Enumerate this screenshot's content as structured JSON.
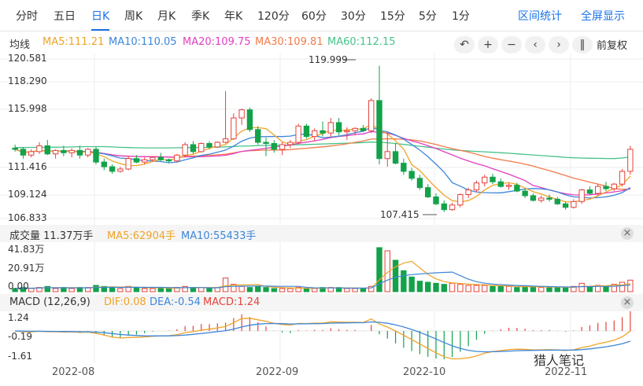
{
  "tabs": [
    "分时",
    "五日",
    "日K",
    "周K",
    "月K",
    "季K",
    "年K",
    "120分",
    "60分",
    "30分",
    "15分",
    "5分",
    "1分"
  ],
  "active_tab": "日K",
  "right_links": [
    "区间统计",
    "全屏显示"
  ],
  "ma_bar": {
    "label": "均线",
    "ma5": "MA5:111.21",
    "ma10": "MA10:110.05",
    "ma20": "MA20:109.75",
    "ma30": "MA30:109.81",
    "ma60": "MA60:112.15"
  },
  "tools": [
    "↶",
    "+",
    "−",
    "‹",
    "›",
    "‖"
  ],
  "adjust": "前复权",
  "price_axis": [
    "120.581",
    "118.290",
    "115.998",
    "111.416",
    "109.124",
    "106.833"
  ],
  "annotations": {
    "high": "119.999",
    "low": "107.415"
  },
  "vol_bar": {
    "label": "成交量 11.37万手",
    "ma5": "MA5:62904手",
    "ma10": "MA10:55433手"
  },
  "vol_axis": [
    "41.83万",
    "20.91万",
    "0.00"
  ],
  "macd_bar": {
    "label": "MACD (12,26,9)",
    "dif": "DIF:0.08",
    "dea": "DEA:-0.54",
    "macd": "MACD:1.24"
  },
  "macd_axis": [
    "1.24",
    "-0.19",
    "-1.61"
  ],
  "dates": [
    "2022-08",
    "2022-09",
    "2022-10",
    "2022-11"
  ],
  "watermark": "猎人笔记",
  "colors": {
    "up": "#e5433b",
    "down": "#13a24a",
    "ma5": "#f0a327",
    "ma10": "#3d86d8",
    "ma20": "#e23fbf",
    "ma30": "#f37a4a",
    "ma60": "#46c28b",
    "link": "#1a73e8"
  },
  "chart_data": {
    "type": "candlestick",
    "ylim": [
      106.833,
      120.581
    ],
    "ohlc": [
      [
        112.9,
        113.2,
        112.6,
        112.8
      ],
      [
        112.8,
        113.0,
        112.0,
        112.3
      ],
      [
        112.3,
        112.8,
        112.1,
        112.6
      ],
      [
        112.6,
        113.4,
        112.4,
        113.1
      ],
      [
        113.1,
        113.6,
        112.3,
        112.4
      ],
      [
        112.4,
        112.8,
        112.0,
        112.7
      ],
      [
        112.7,
        113.1,
        112.2,
        112.5
      ],
      [
        112.5,
        112.9,
        112.1,
        112.7
      ],
      [
        112.7,
        113.1,
        112.0,
        112.3
      ],
      [
        112.3,
        112.9,
        112.1,
        112.8
      ],
      [
        112.8,
        113.0,
        111.5,
        111.7
      ],
      [
        111.7,
        112.0,
        111.0,
        111.3
      ],
      [
        111.3,
        111.5,
        110.7,
        110.9
      ],
      [
        110.9,
        111.3,
        110.8,
        111.1
      ],
      [
        111.1,
        112.2,
        111.0,
        112.0
      ],
      [
        112.0,
        112.3,
        111.6,
        111.7
      ],
      [
        111.7,
        112.1,
        111.5,
        111.9
      ],
      [
        111.9,
        112.2,
        111.7,
        112.1
      ],
      [
        112.1,
        112.5,
        111.8,
        111.9
      ],
      [
        111.9,
        112.0,
        111.6,
        111.8
      ],
      [
        111.8,
        112.4,
        111.7,
        112.3
      ],
      [
        112.3,
        113.4,
        112.1,
        113.2
      ],
      [
        113.2,
        113.5,
        112.4,
        112.6
      ],
      [
        112.6,
        113.4,
        112.5,
        113.3
      ],
      [
        113.3,
        113.5,
        112.8,
        113.0
      ],
      [
        113.0,
        113.5,
        112.9,
        113.4
      ],
      [
        113.4,
        117.8,
        113.3,
        113.7
      ],
      [
        113.7,
        115.9,
        113.6,
        115.5
      ],
      [
        115.5,
        116.3,
        114.9,
        116.2
      ],
      [
        116.2,
        116.4,
        114.3,
        114.5
      ],
      [
        114.5,
        114.8,
        113.2,
        113.4
      ],
      [
        113.4,
        113.8,
        112.2,
        113.3
      ],
      [
        113.3,
        113.6,
        112.5,
        112.8
      ],
      [
        112.8,
        113.4,
        112.3,
        113.2
      ],
      [
        113.2,
        113.6,
        112.9,
        113.4
      ],
      [
        113.4,
        115.0,
        113.2,
        114.8
      ],
      [
        114.8,
        115.0,
        113.7,
        113.9
      ],
      [
        113.9,
        114.6,
        113.5,
        114.4
      ],
      [
        114.4,
        115.2,
        113.9,
        114.2
      ],
      [
        114.2,
        115.5,
        113.8,
        115.1
      ],
      [
        115.1,
        115.5,
        114.0,
        114.3
      ],
      [
        114.3,
        114.7,
        113.6,
        114.4
      ],
      [
        114.4,
        114.7,
        114.0,
        114.6
      ],
      [
        114.6,
        114.9,
        114.3,
        114.4
      ],
      [
        114.4,
        117.2,
        114.2,
        117.0
      ],
      [
        117.0,
        120.0,
        111.5,
        112.0
      ],
      [
        112.0,
        114.2,
        111.3,
        112.6
      ],
      [
        112.6,
        113.3,
        111.5,
        111.6
      ],
      [
        111.6,
        112.0,
        110.6,
        110.9
      ],
      [
        110.9,
        111.2,
        110.1,
        110.3
      ],
      [
        110.3,
        110.6,
        109.3,
        109.5
      ],
      [
        109.5,
        109.8,
        108.6,
        108.7
      ],
      [
        108.7,
        109.0,
        108.0,
        108.1
      ],
      [
        108.1,
        108.4,
        107.4,
        107.6
      ],
      [
        107.6,
        108.2,
        107.5,
        108.0
      ],
      [
        108.0,
        109.0,
        107.8,
        108.9
      ],
      [
        108.9,
        109.5,
        108.6,
        109.3
      ],
      [
        109.3,
        110.1,
        109.1,
        109.9
      ],
      [
        109.9,
        110.6,
        109.6,
        110.4
      ],
      [
        110.4,
        110.7,
        109.8,
        110.0
      ],
      [
        110.0,
        110.3,
        109.5,
        109.6
      ],
      [
        109.6,
        109.9,
        109.3,
        109.7
      ],
      [
        109.7,
        109.9,
        109.1,
        109.2
      ],
      [
        109.2,
        109.4,
        108.6,
        108.8
      ],
      [
        108.8,
        109.0,
        108.3,
        108.4
      ],
      [
        108.4,
        108.8,
        108.2,
        108.6
      ],
      [
        108.6,
        108.9,
        108.3,
        108.5
      ],
      [
        108.5,
        108.7,
        108.0,
        108.1
      ],
      [
        108.1,
        108.3,
        107.6,
        107.8
      ],
      [
        107.8,
        108.5,
        107.7,
        108.3
      ],
      [
        108.3,
        109.4,
        108.1,
        109.3
      ],
      [
        109.3,
        109.6,
        108.9,
        109.0
      ],
      [
        109.0,
        109.8,
        108.8,
        109.6
      ],
      [
        109.6,
        110.0,
        109.2,
        109.4
      ],
      [
        109.4,
        109.9,
        109.2,
        109.8
      ],
      [
        109.8,
        111.1,
        109.6,
        110.9
      ],
      [
        110.9,
        113.1,
        110.6,
        112.8
      ]
    ],
    "volume": [
      3,
      4,
      3,
      4,
      5,
      3,
      4,
      3,
      4,
      4,
      6,
      5,
      4,
      3,
      5,
      4,
      3,
      3,
      4,
      3,
      4,
      5,
      4,
      4,
      3,
      4,
      13,
      7,
      5,
      4,
      5,
      4,
      3,
      3,
      3,
      4,
      3,
      3,
      4,
      4,
      4,
      3,
      3,
      3,
      5,
      42,
      39,
      30,
      20,
      14,
      10,
      9,
      8,
      7,
      8,
      7,
      6,
      6,
      6,
      5,
      5,
      5,
      4,
      5,
      5,
      4,
      4,
      4,
      4,
      5,
      8,
      5,
      6,
      5,
      7,
      9,
      11
    ],
    "ma60": [
      112.95,
      112.95,
      112.96,
      112.96,
      112.97,
      112.98,
      112.99,
      113.0,
      113.02,
      113.03,
      113.03,
      113.03,
      113.0,
      112.97,
      112.95,
      112.93,
      112.92,
      112.92,
      112.92,
      112.92,
      112.93,
      112.94,
      112.95,
      112.96,
      112.97,
      112.99,
      113.01,
      113.04,
      113.07,
      113.09,
      113.12,
      113.14,
      113.15,
      113.16,
      113.17,
      113.19,
      113.21,
      113.23,
      113.26,
      113.28,
      113.31,
      113.33,
      113.35,
      113.38,
      113.42,
      113.4,
      113.36,
      113.3,
      113.22,
      113.14,
      113.06,
      112.98,
      112.9,
      112.82,
      112.75,
      112.7,
      112.66,
      112.62,
      112.58,
      112.54,
      112.5,
      112.46,
      112.41,
      112.36,
      112.31,
      112.26,
      112.21,
      112.16,
      112.11,
      112.07,
      112.05,
      112.03,
      112.02,
      112.01,
      112.0,
      112.05,
      112.15
    ]
  }
}
